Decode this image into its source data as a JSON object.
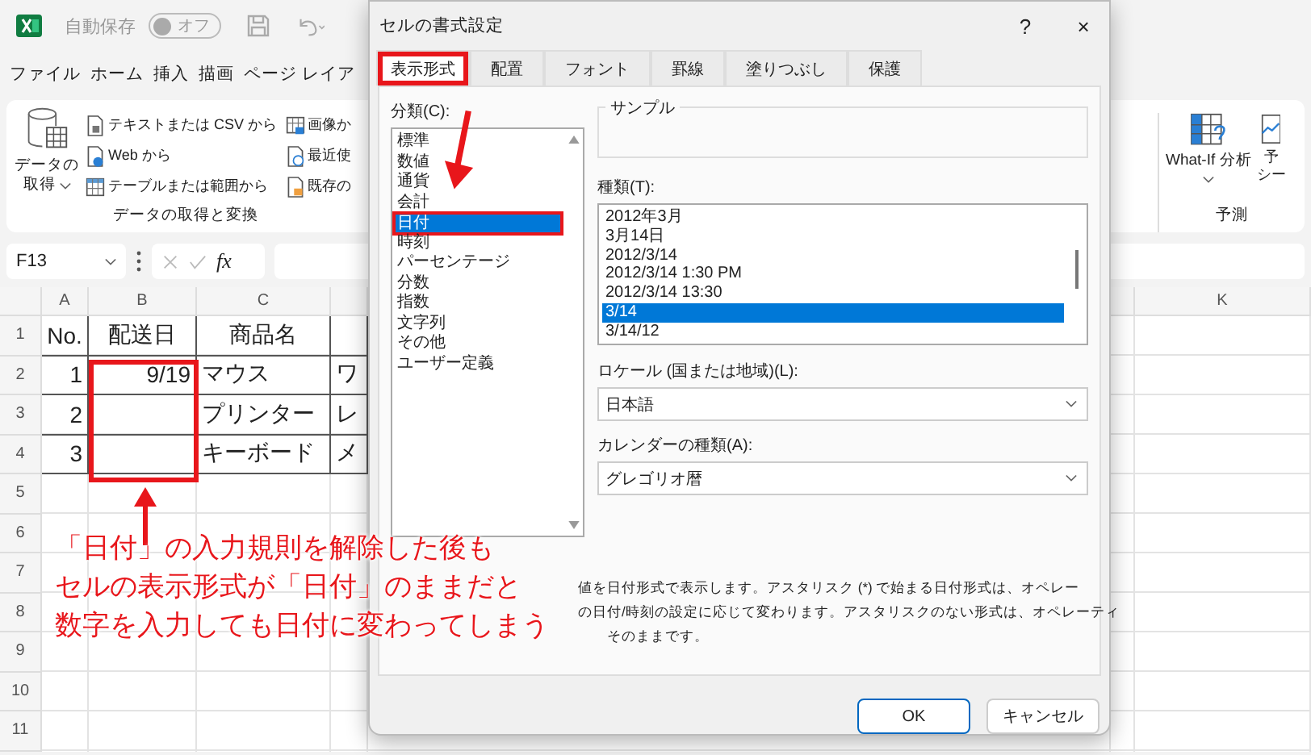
{
  "title_bar": {
    "autosave_label": "自動保存",
    "autosave_toggle": {
      "label": "オフ",
      "on": false
    }
  },
  "menu": [
    "ファイル",
    "ホーム",
    "挿入",
    "描画",
    "ページ レイア"
  ],
  "ribbon": {
    "get_data_lines": [
      "データの",
      "取得"
    ],
    "commands": [
      {
        "kind": "text-file",
        "label": "テキストまたは CSV から"
      },
      {
        "kind": "web",
        "label": "Web から"
      },
      {
        "kind": "table",
        "label": "テーブルまたは範囲から"
      },
      {
        "kind": "image",
        "label": "画像か"
      },
      {
        "kind": "recent",
        "label": "最近使"
      },
      {
        "kind": "existing",
        "label": "既存の"
      }
    ],
    "group_label": "データの取得と変換",
    "what_if": "What-If 分析",
    "forecast_group": "予測",
    "forecast_lines": [
      "予",
      "シー"
    ]
  },
  "formula_bar": {
    "name_box": "F13",
    "fx": "fx"
  },
  "sheet": {
    "column_headers": [
      "A",
      "B",
      "C",
      "K"
    ],
    "row_headers": [
      "1",
      "2",
      "3",
      "4",
      "5",
      "6",
      "7",
      "8",
      "9",
      "10",
      "11"
    ],
    "rows": [
      {
        "col_a": "No.",
        "col_b": "配送日",
        "col_c": "商品名"
      },
      {
        "col_a": "1",
        "col_b": "9/19",
        "col_c": "マウス",
        "col_4": "ワ"
      },
      {
        "col_a": "2",
        "col_c": "プリンター",
        "col_4": "レ"
      },
      {
        "col_a": "3",
        "col_c": "キーボード",
        "col_4": "メ"
      }
    ]
  },
  "dialog": {
    "title": "セルの書式設定",
    "help": "?",
    "close": "×",
    "tabs": [
      {
        "label": "表示形式",
        "selected": true
      },
      {
        "label": "配置",
        "selected": false
      },
      {
        "label": "フォント",
        "selected": false
      },
      {
        "label": "罫線",
        "selected": false
      },
      {
        "label": "塗りつぶし",
        "selected": false
      },
      {
        "label": "保護",
        "selected": false
      }
    ],
    "category_label": "分類(C):",
    "categories": [
      {
        "label": "標準",
        "selected": false
      },
      {
        "label": "数値",
        "selected": false
      },
      {
        "label": "通貨",
        "selected": false
      },
      {
        "label": "会計",
        "selected": false
      },
      {
        "label": "日付",
        "selected": true
      },
      {
        "label": "時刻",
        "selected": false
      },
      {
        "label": "パーセンテージ",
        "selected": false
      },
      {
        "label": "分数",
        "selected": false
      },
      {
        "label": "指数",
        "selected": false
      },
      {
        "label": "文字列",
        "selected": false
      },
      {
        "label": "その他",
        "selected": false
      },
      {
        "label": "ユーザー定義",
        "selected": false
      }
    ],
    "sample_label": "サンプル",
    "type_label": "種類(T):",
    "types": [
      {
        "label": "2012年3月",
        "selected": false
      },
      {
        "label": "3月14日",
        "selected": false
      },
      {
        "label": "2012/3/14",
        "selected": false
      },
      {
        "label": "2012/3/14 1:30 PM",
        "selected": false
      },
      {
        "label": "2012/3/14 13:30",
        "selected": false
      },
      {
        "label": "3/14",
        "selected": true
      },
      {
        "label": "3/14/12",
        "selected": false
      }
    ],
    "locale_label": "ロケール (国または地域)(L):",
    "locale_value": "日本語",
    "calendar_label": "カレンダーの種類(A):",
    "calendar_value": "グレゴリオ暦",
    "description_lines": [
      "値を日付形式で表示します。アスタリスク (*) で始まる日付形式は、オペレー",
      "の日付/時刻の設定に応じて変わります。アスタリスクのない形式は、オペレーティ",
      "そのままです。"
    ],
    "buttons": [
      "OK",
      "キャンセル"
    ]
  },
  "annotation": {
    "lines": [
      "「日付」の入力規則を解除した後も",
      "セルの表示形式が「日付」のままだと",
      "数字を入力しても日付に変わってしまう"
    ]
  }
}
